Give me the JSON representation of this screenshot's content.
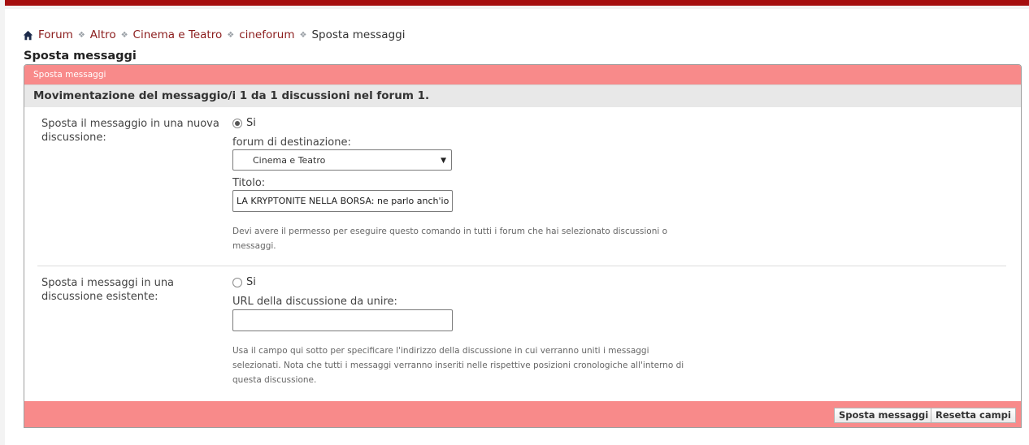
{
  "breadcrumb": {
    "items": [
      "Forum",
      "Altro",
      "Cinema e Teatro",
      "cineforum"
    ],
    "current": "Sposta messaggi"
  },
  "page_title": "Sposta messaggi",
  "panel": {
    "header": "Sposta messaggi",
    "section_title": "Movimentazione del messaggio/i 1 da 1 discussioni nel forum 1."
  },
  "option_new": {
    "label": "Sposta il messaggio in una nuova discussione:",
    "radio_label": "Si",
    "checked": true,
    "forum_label": "forum di destinazione:",
    "forum_value": "Cinema e Teatro",
    "title_label": "Titolo:",
    "title_value": "LA KRYPTONITE NELLA BORSA: ne parlo anch'io",
    "hint": "Devi avere il permesso per eseguire questo comando in tutti i forum che hai selezionato discussioni o messaggi."
  },
  "option_existing": {
    "label": "Sposta i messaggi in una discussione esistente:",
    "radio_label": "Si",
    "checked": false,
    "url_label": "URL della discussione da unire:",
    "url_value": "",
    "hint": "Usa il campo qui sotto per specificare l'indirizzo della discussione in cui verranno uniti i messaggi selezionati. Nota che tutti i messaggi verranno inseriti nelle rispettive posizioni cronologiche all'interno di questa discussione."
  },
  "buttons": {
    "submit": "Sposta messaggi",
    "reset": "Resetta campi"
  },
  "colors": {
    "accent": "#a50e0e",
    "panel_header": "#f88a8a",
    "link": "#8b1c1c"
  }
}
